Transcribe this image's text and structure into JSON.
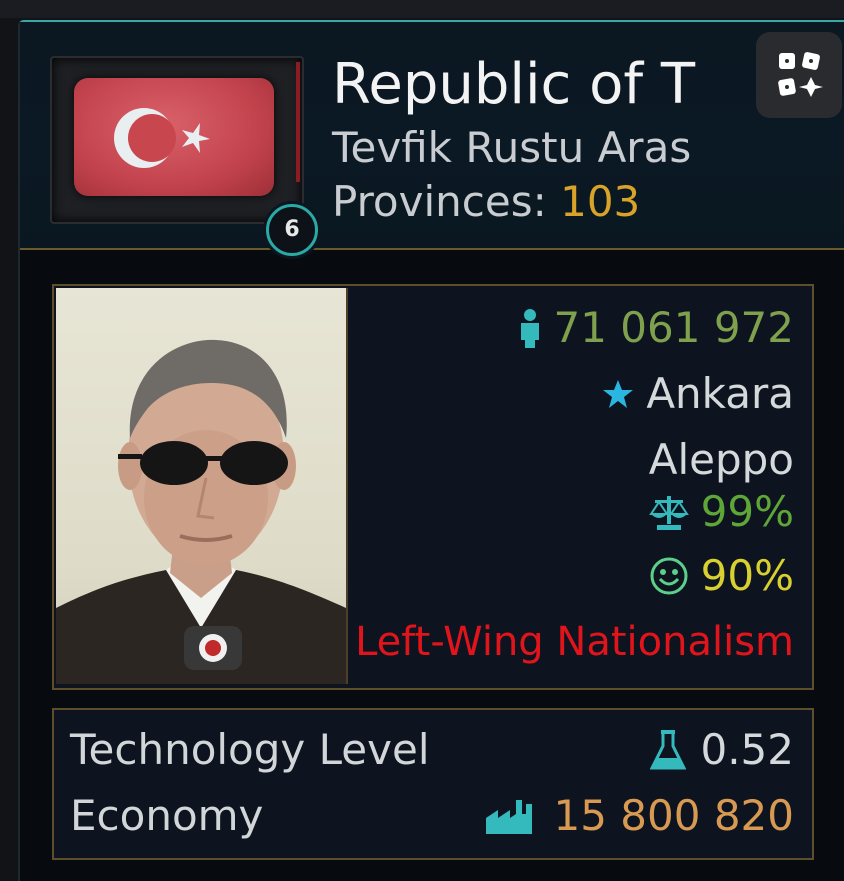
{
  "country": {
    "title": "Republic of T",
    "leader": "Tevfik Rustu Aras",
    "provinces_label": "Provinces:",
    "provinces_value": "103",
    "rank": "6"
  },
  "stats": {
    "population": "71 061 972",
    "capital": "Ankara",
    "second_city": "Aleppo",
    "stability": "99%",
    "happiness": "90%",
    "ideology": "Left-Wing Nationalism"
  },
  "bottom": {
    "tech_label": "Technology Level",
    "tech_value": "0.52",
    "economy_label": "Economy",
    "economy_value": "15 800 820"
  },
  "icons": {
    "population": "person-icon",
    "capital": "star-icon",
    "stability": "scales-icon",
    "happiness": "smiley-icon",
    "tech": "flask-icon",
    "economy": "factory-icon",
    "menu": "dice-icon"
  },
  "colors": {
    "accent": "#2ba9a4",
    "population": "#7fa14e",
    "stability": "#5fa639",
    "happiness": "#d8d030",
    "provinces": "#d8a328",
    "economy": "#d89a52",
    "ideology": "#e1141c"
  }
}
